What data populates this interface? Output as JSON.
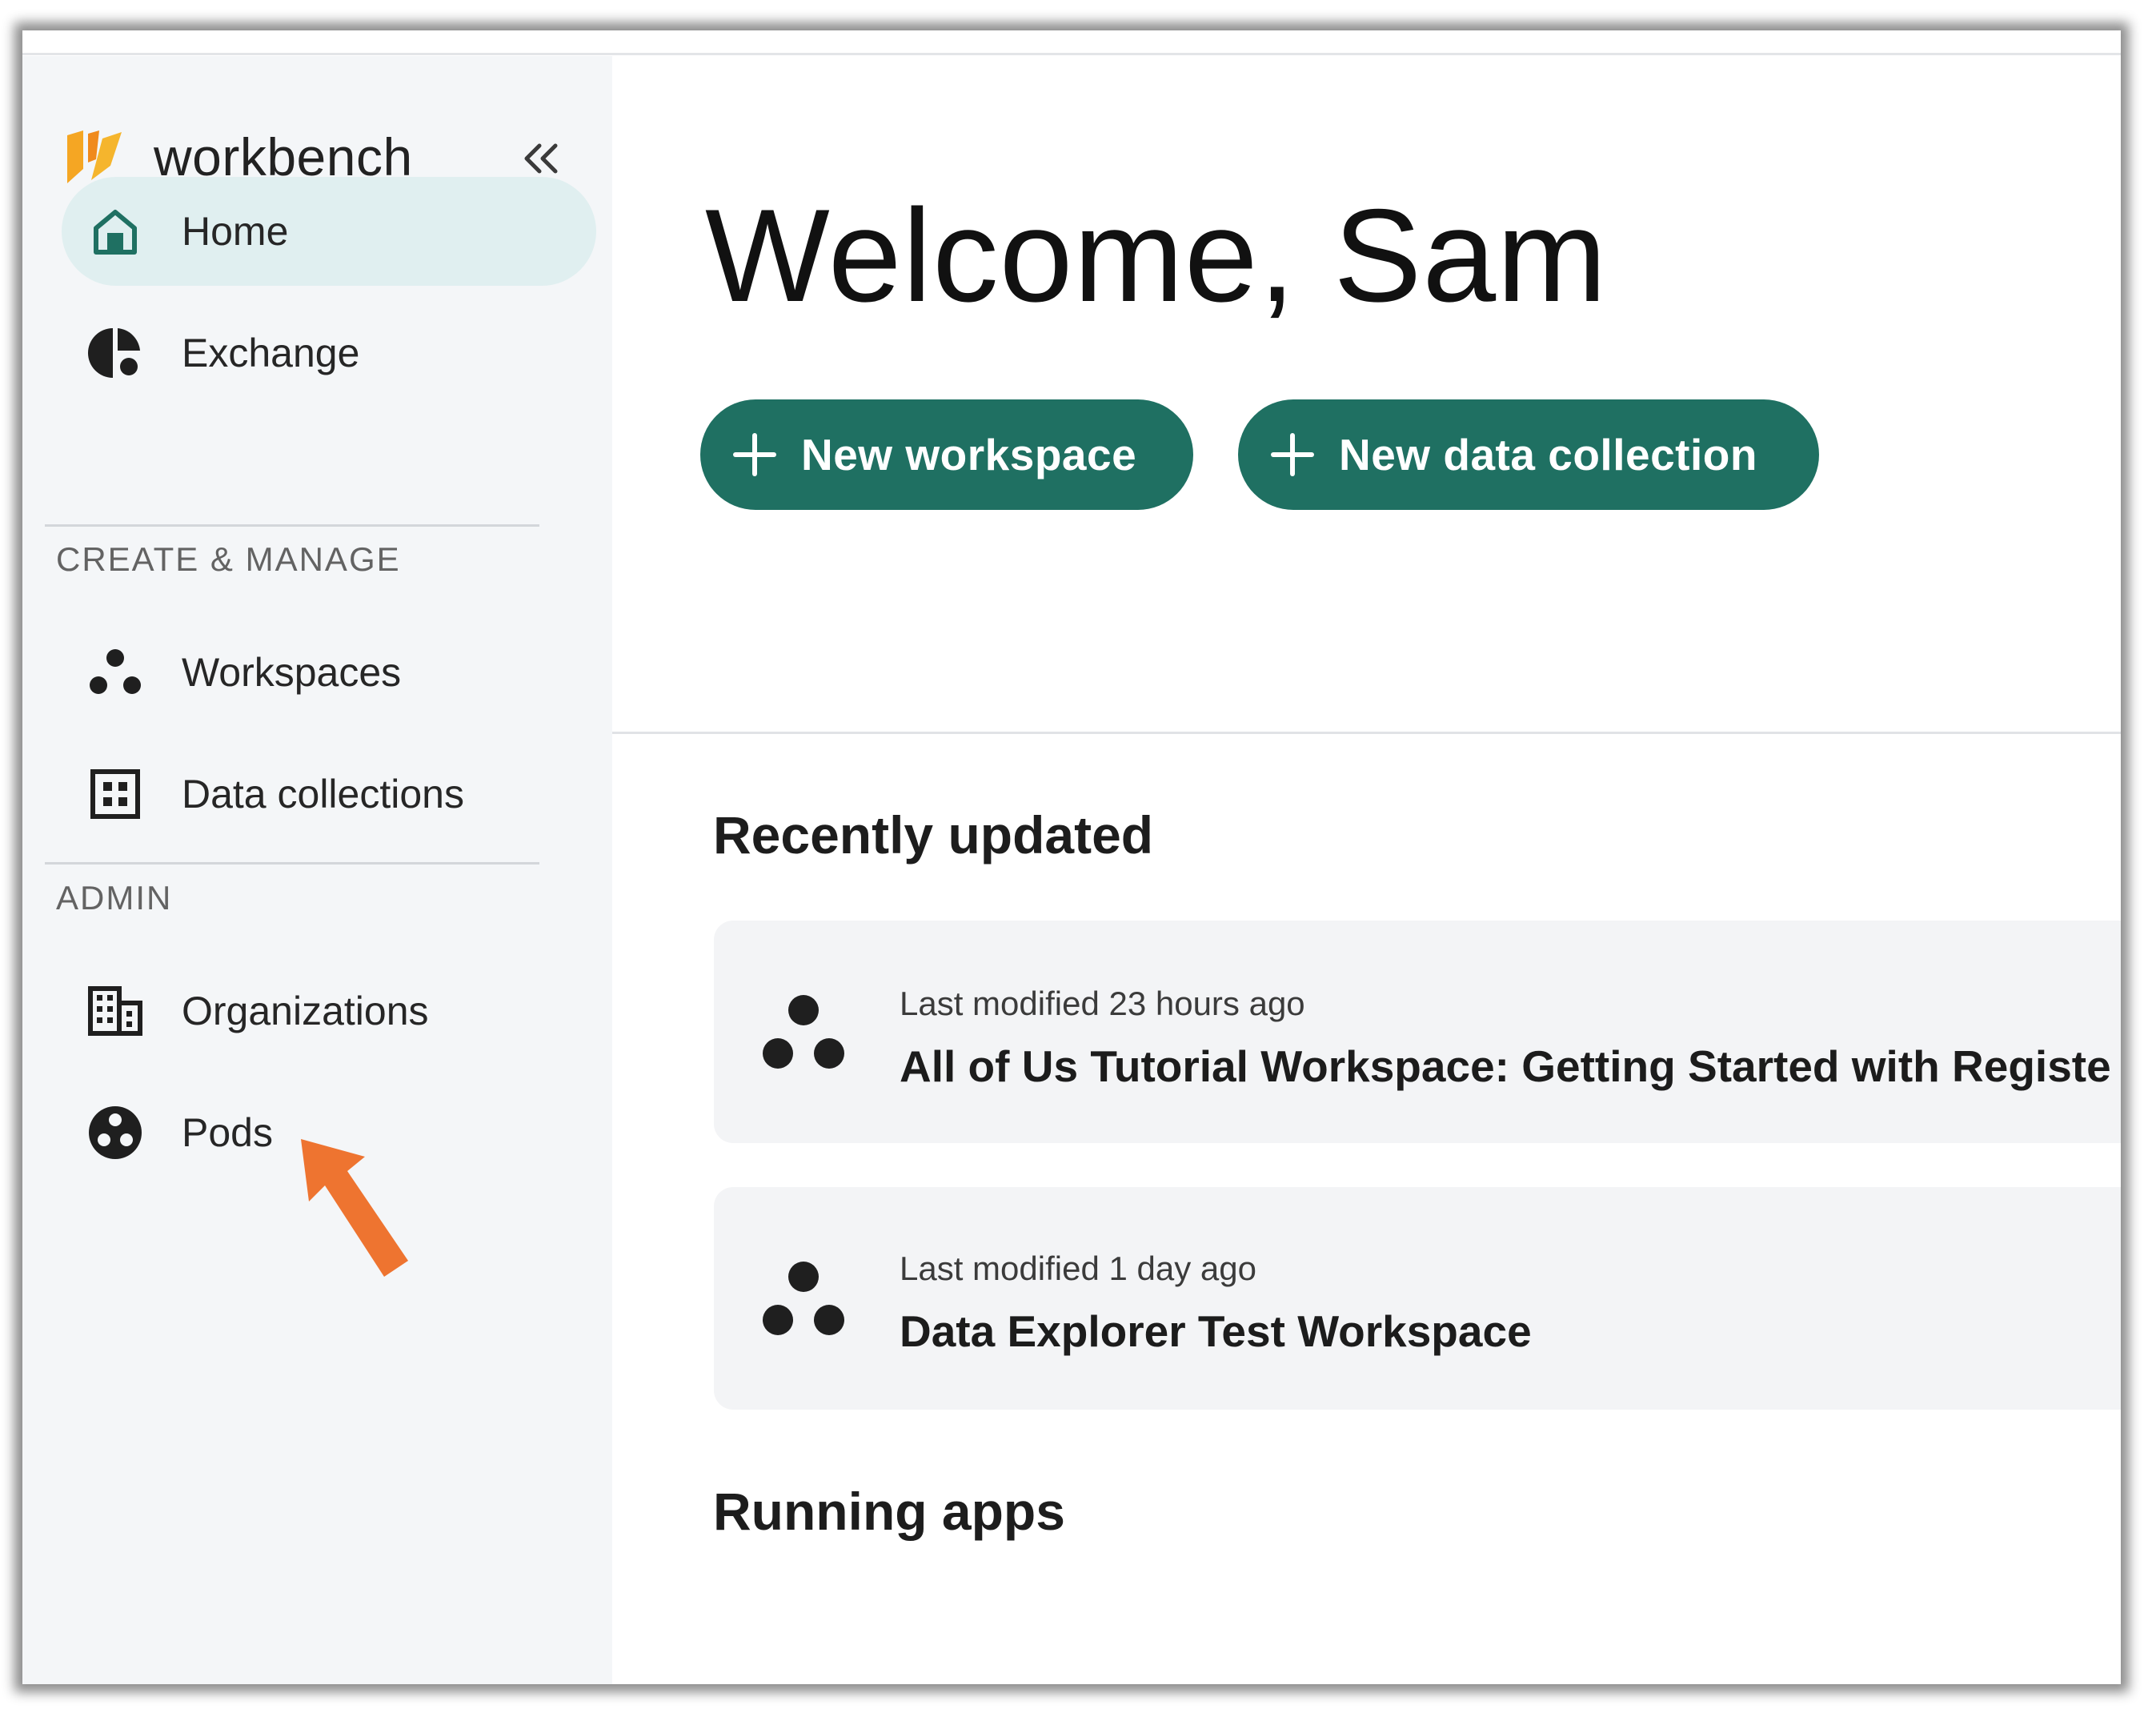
{
  "app": {
    "name": "workbench"
  },
  "sidebar": {
    "nav": [
      {
        "label": "Home",
        "icon": "home-icon",
        "active": true
      },
      {
        "label": "Exchange",
        "icon": "exchange-icon",
        "active": false
      }
    ],
    "sections": [
      {
        "title": "CREATE & MANAGE",
        "items": [
          {
            "label": "Workspaces",
            "icon": "workspaces-icon"
          },
          {
            "label": "Data collections",
            "icon": "data-collections-icon"
          }
        ]
      },
      {
        "title": "ADMIN",
        "items": [
          {
            "label": "Organizations",
            "icon": "organizations-icon"
          },
          {
            "label": "Pods",
            "icon": "pods-icon"
          }
        ]
      }
    ]
  },
  "main": {
    "welcome": "Welcome, Sam",
    "buttons": {
      "new_workspace": "New workspace",
      "new_data_collection": "New data collection"
    },
    "recently_updated": {
      "title": "Recently updated",
      "items": [
        {
          "meta": "Last modified 23 hours ago",
          "title": "All of Us Tutorial Workspace: Getting Started with Registe"
        },
        {
          "meta": "Last modified 1 day ago",
          "title": "Data Explorer Test Workspace"
        }
      ]
    },
    "running_apps": {
      "title": "Running apps"
    }
  },
  "colors": {
    "accent": "#1f7062",
    "active_nav_bg": "#e0eff0",
    "sidebar_bg": "#f4f6f8",
    "annotation_arrow": "#ee7430"
  }
}
